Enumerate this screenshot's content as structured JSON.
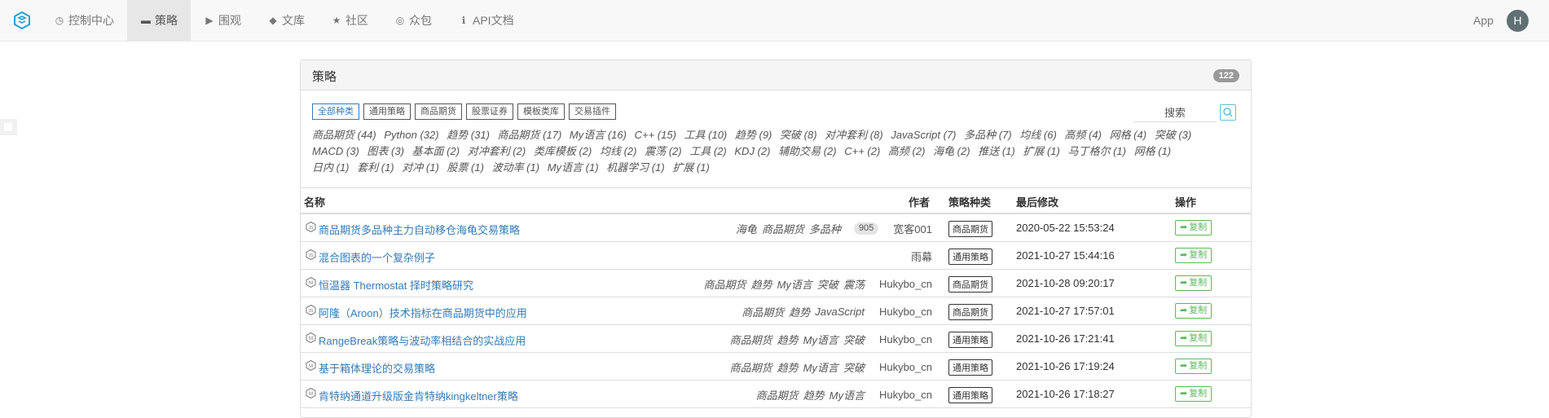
{
  "nav": {
    "logo_icon": "fmz-logo-icon",
    "items": [
      {
        "label": "控制中心",
        "icon": "dashboard-icon",
        "glyph": "◷"
      },
      {
        "label": "策略",
        "icon": "cart-icon",
        "glyph": "▬"
      },
      {
        "label": "围观",
        "icon": "play-circle-icon",
        "glyph": "▶"
      },
      {
        "label": "文库",
        "icon": "graduation-cap-icon",
        "glyph": "◆"
      },
      {
        "label": "社区",
        "icon": "star-icon",
        "glyph": "★"
      },
      {
        "label": "众包",
        "icon": "glasses-icon",
        "glyph": "◎"
      },
      {
        "label": "API文档",
        "icon": "info-icon",
        "glyph": "ℹ"
      }
    ],
    "active_index": 1,
    "app_label": "App",
    "avatar_letter": "H"
  },
  "panel": {
    "title": "策略",
    "count": "122",
    "filters": [
      "全部种类",
      "通用策略",
      "商品期货",
      "股票证券",
      "模板类库",
      "交易插件"
    ],
    "active_filter": 0,
    "search_placeholder": "搜索",
    "tags": [
      "商品期货 (44)",
      "Python (32)",
      "趋势 (31)",
      "商品期货 (17)",
      "My语言 (16)",
      "C++ (15)",
      "工具 (10)",
      "趋势 (9)",
      "突破 (8)",
      "对冲套利 (8)",
      "JavaScript (7)",
      "多品种 (7)",
      "均线 (6)",
      "高频 (4)",
      "网格 (4)",
      "突破 (3)",
      "MACD (3)",
      "图表 (3)",
      "基本面 (2)",
      "对冲套利 (2)",
      "类库模板 (2)",
      "均线 (2)",
      "震荡 (2)",
      "工具 (2)",
      "KDJ (2)",
      "辅助交易 (2)",
      "C++ (2)",
      "高频 (2)",
      "海龟 (2)",
      "推送 (1)",
      "扩展 (1)",
      "马丁格尔 (1)",
      "网格 (1)",
      "日内 (1)",
      "套利 (1)",
      "对冲 (1)",
      "股票 (1)",
      "波动率 (1)",
      "My语言 (1)",
      "机器学习 (1)",
      "扩展 (1)"
    ]
  },
  "table": {
    "headers": {
      "name": "名称",
      "author": "作者",
      "category": "策略种类",
      "modified": "最后修改",
      "action": "操作"
    },
    "copy_label": "复制",
    "rows": [
      {
        "name": "商品期货多品种主力自动移仓海龟交易策略",
        "icon": "js-badge-icon",
        "tags": [
          "海龟",
          "商品期货",
          "多品种"
        ],
        "stars": "905",
        "author": "宽客001",
        "category": "商品期货",
        "time": "2020-05-22 15:53:24"
      },
      {
        "name": "混合图表的一个复杂例子",
        "icon": "js-badge-icon",
        "tags": [],
        "stars": "",
        "author": "雨幕",
        "category": "通用策略",
        "time": "2021-10-27 15:44:16"
      },
      {
        "name": "恒温器 Thermostat 择时策略研究",
        "icon": "m-badge-icon",
        "tags": [
          "商品期货",
          "趋势",
          "My语言",
          "突破",
          "震荡"
        ],
        "stars": "",
        "author": "Hukybo_cn",
        "category": "商品期货",
        "time": "2021-10-28 09:20:17"
      },
      {
        "name": "阿隆（Aroon）技术指标在商品期货中的应用",
        "icon": "js-badge-icon",
        "tags": [
          "商品期货",
          "趋势",
          "JavaScript"
        ],
        "stars": "",
        "author": "Hukybo_cn",
        "category": "商品期货",
        "time": "2021-10-27 17:57:01"
      },
      {
        "name": "RangeBreak策略与波动率相结合的实战应用",
        "icon": "m-badge-icon",
        "tags": [
          "商品期货",
          "趋势",
          "My语言",
          "突破"
        ],
        "stars": "",
        "author": "Hukybo_cn",
        "category": "通用策略",
        "time": "2021-10-26 17:21:41"
      },
      {
        "name": "基于箱体理论的交易策略",
        "icon": "m-badge-icon",
        "tags": [
          "商品期货",
          "趋势",
          "My语言",
          "突破"
        ],
        "stars": "",
        "author": "Hukybo_cn",
        "category": "通用策略",
        "time": "2021-10-26 17:19:24"
      },
      {
        "name": "肯特纳通道升级版金肯特纳kingkeltner策略",
        "icon": "m-badge-icon",
        "tags": [
          "商品期货",
          "趋势",
          "My语言"
        ],
        "stars": "",
        "author": "Hukybo_cn",
        "category": "通用策略",
        "time": "2021-10-26 17:18:27"
      }
    ]
  },
  "colors": {
    "link": "#337ab7",
    "copy": "#5cb85c",
    "navbar": "#f8f8f8"
  }
}
